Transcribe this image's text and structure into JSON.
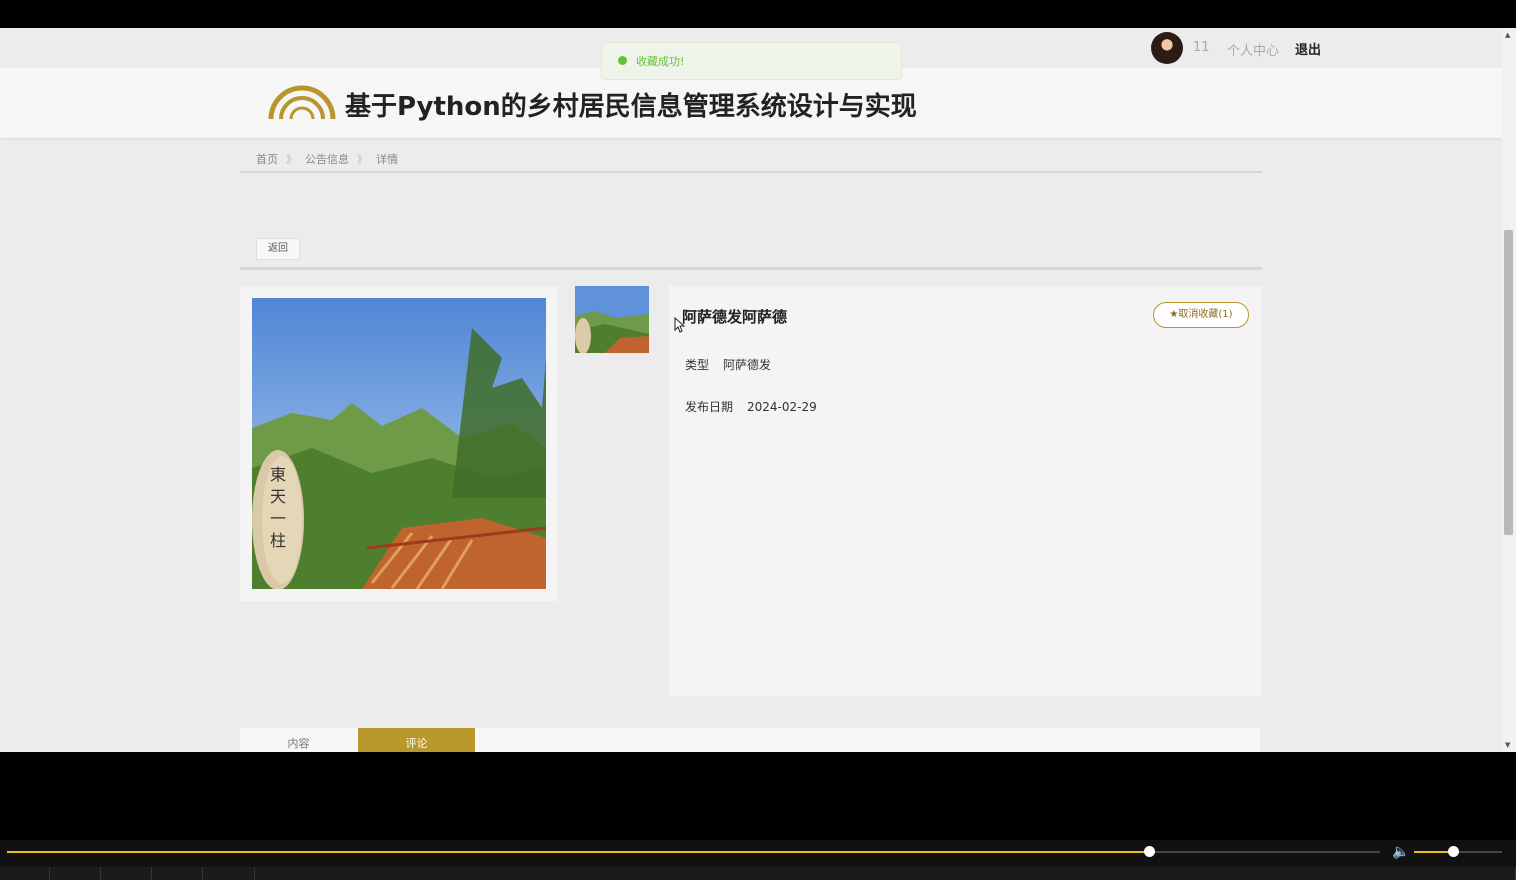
{
  "user": {
    "id_text": "11",
    "center_label": "个人中心",
    "logout_label": "退出"
  },
  "toast": {
    "message": "收藏成功!"
  },
  "site": {
    "title": "基于Python的乡村居民信息管理系统设计与实现"
  },
  "breadcrumb": [
    "首页",
    "公告信息",
    "详情"
  ],
  "breadcrumb_sep": "》",
  "back_label": "返回",
  "detail": {
    "title": "阿萨德发阿萨德",
    "favorite_label": "★取消收藏(1)",
    "fields": [
      {
        "label": "类型",
        "value": "阿萨德发"
      },
      {
        "label": "发布日期",
        "value": "2024-02-29"
      }
    ],
    "stone_text": "東天一柱"
  },
  "tabs": [
    {
      "label": "内容",
      "active": false
    },
    {
      "label": "评论",
      "active": true
    }
  ],
  "player": {
    "progress": 0.832,
    "volume": 0.44
  },
  "colors": {
    "accent": "#b8972d",
    "toast_green": "#67c23a",
    "progress": "#e8c21a"
  }
}
